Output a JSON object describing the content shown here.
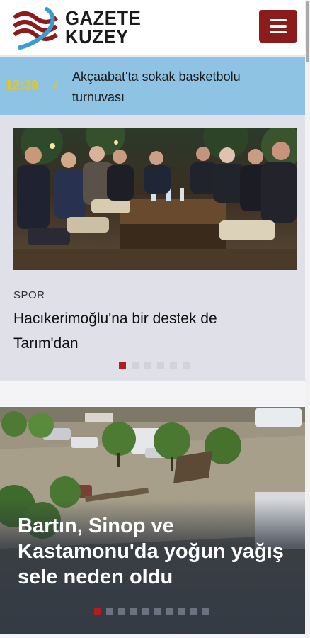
{
  "header": {
    "logo_line1": "GAZETE",
    "logo_line2": "KUZEY",
    "menu_icon": "hamburger-menu-icon",
    "accent_color": "#8c1b1b"
  },
  "ticker": {
    "time": "12:39",
    "separator": "/",
    "headline": "Akçaabat'ta sokak basketbolu turnuvası",
    "background": "#8ec3e4"
  },
  "slider_top": {
    "category": "SPOR",
    "title": "Hacıkerimoğlu'na bir destek de Tarım'dan",
    "slide_count": 6,
    "active_index": 0
  },
  "slider_main": {
    "title": "Bartın, Sinop ve Kastamonu'da yoğun yağış sele neden oldu",
    "slide_count": 10,
    "active_index": 0
  }
}
